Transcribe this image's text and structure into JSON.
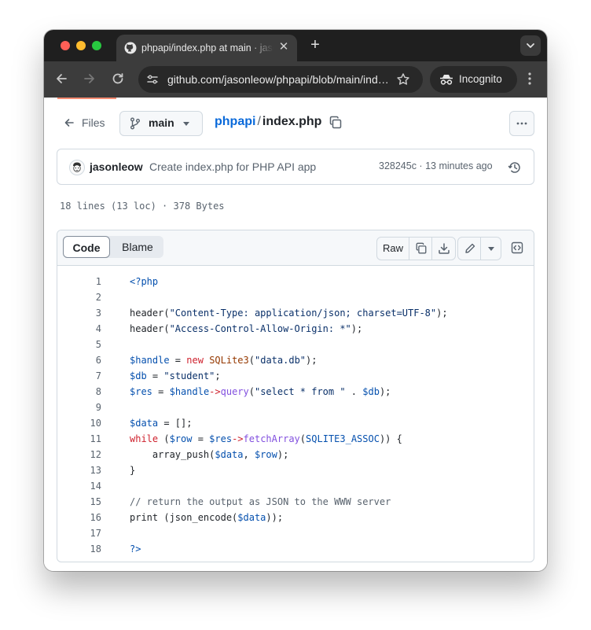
{
  "browser": {
    "tab_title": "phpapi/index.php at main · jasonleow/phpapi",
    "url": "github.com/jasonleow/phpapi/blob/main/index.php",
    "incognito_label": "Incognito"
  },
  "github": {
    "files_label": "Files",
    "branch": "main",
    "repo": "phpapi",
    "separator": "/",
    "filename": "index.php",
    "commit": {
      "author": "jasonleow",
      "message": "Create index.php for PHP API app",
      "meta": "328245c · 13 minutes ago"
    },
    "file_info": "18 lines (13 loc) · 378 Bytes",
    "tabs": {
      "code": "Code",
      "blame": "Blame"
    },
    "raw_label": "Raw"
  },
  "code_lines": [
    "<?php",
    "",
    "header(\"Content-Type: application/json; charset=UTF-8\");",
    "header(\"Access-Control-Allow-Origin: *\");",
    "",
    "$handle = new SQLite3(\"data.db\");",
    "$db = \"student\";",
    "$res = $handle->query(\"select * from \" . $db);",
    "",
    "$data = [];",
    "while ($row = $res->fetchArray(SQLITE3_ASSOC)) {",
    "    array_push($data, $row);",
    "}",
    "",
    "// return the output as JSON to the WWW server",
    "print (json_encode($data));",
    "",
    "?>"
  ],
  "colors": {
    "link": "#0969da",
    "keyword": "#cf222e",
    "function": "#8250df",
    "string": "#0a3069",
    "comment": "#59636e",
    "constant": "#0550ae",
    "class": "#953800",
    "titlebar": "#1f1f1f",
    "toolbar": "#3c3c3c"
  },
  "icons": [
    "github-favicon",
    "close-icon",
    "plus-icon",
    "chevron-down-icon",
    "back-arrow-icon",
    "forward-arrow-icon",
    "reload-icon",
    "site-info-icon",
    "star-icon",
    "incognito-icon",
    "kebab-icon",
    "arrow-left-icon",
    "git-branch-icon",
    "copy-icon",
    "kebab-horizontal-icon",
    "history-icon",
    "download-icon",
    "pencil-icon",
    "code-square-icon"
  ]
}
